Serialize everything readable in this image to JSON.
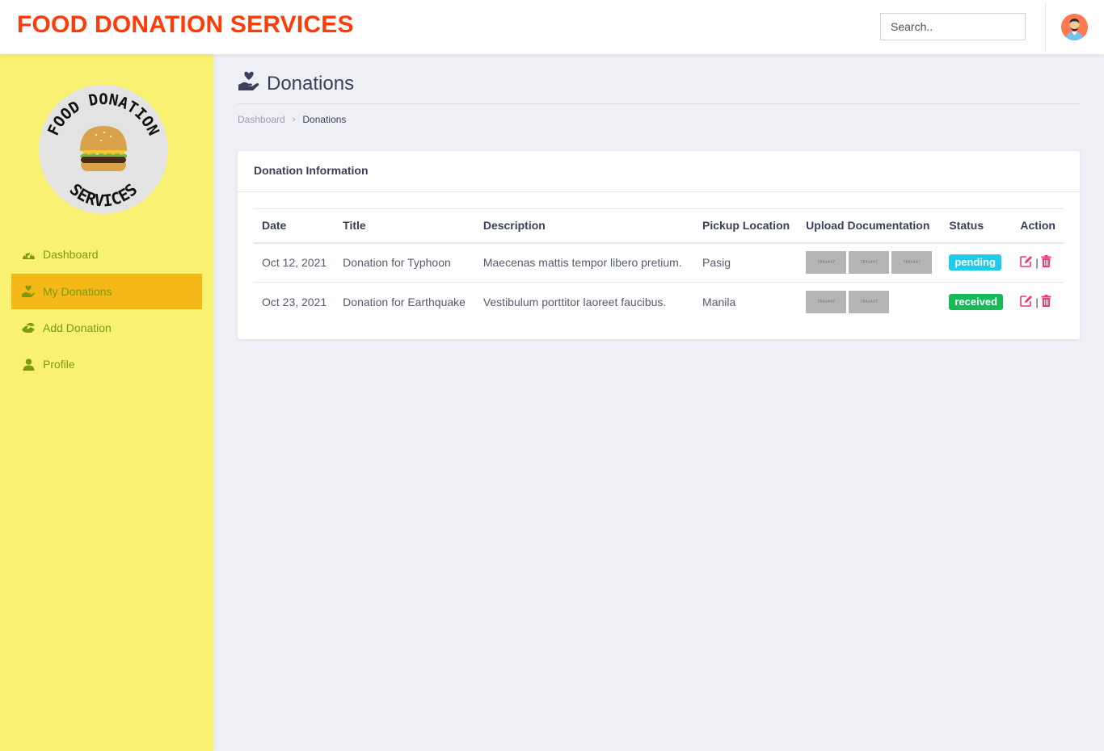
{
  "header": {
    "brand": "FOOD DONATION SERVICES",
    "search_placeholder": "Search.."
  },
  "sidebar": {
    "logo_text_top": "FOOD DONATION",
    "logo_text_bottom": "SERVICES",
    "items": [
      {
        "label": "Dashboard",
        "icon": "gauge-icon"
      },
      {
        "label": "My Donations",
        "icon": "hand-heart-icon",
        "active": true
      },
      {
        "label": "Add Donation",
        "icon": "hands-helping-icon"
      },
      {
        "label": "Profile",
        "icon": "user-icon"
      }
    ]
  },
  "main": {
    "page_title": "Donations",
    "breadcrumb": [
      "Dashboard",
      "Donations"
    ],
    "card_title": "Donation Information",
    "table": {
      "headers": [
        "Date",
        "Title",
        "Description",
        "Pickup Location",
        "Upload Documentation",
        "Status",
        "Action"
      ],
      "rows": [
        {
          "date": "Oct 12, 2021",
          "title": "Donation for Typhoon",
          "description": "Maecenas mattis tempor libero pretium.",
          "location": "Pasig",
          "thumbs": [
            "784x447",
            "784x447",
            "784x447"
          ],
          "status": "pending"
        },
        {
          "date": "Oct 23, 2021",
          "title": "Donation for Earthquake",
          "description": "Vestibulum porttitor laoreet faucibus.",
          "location": "Manila",
          "thumbs": [
            "784x447",
            "784x447"
          ],
          "status": "received"
        }
      ]
    }
  },
  "colors": {
    "brand": "#ff3b0a",
    "sidebar_bg": "#f9f172",
    "sidebar_active": "#f4b918",
    "nav_text": "#7d9a12",
    "pending": "#1fcbed",
    "received": "#19b957",
    "action": "#f0386b"
  }
}
